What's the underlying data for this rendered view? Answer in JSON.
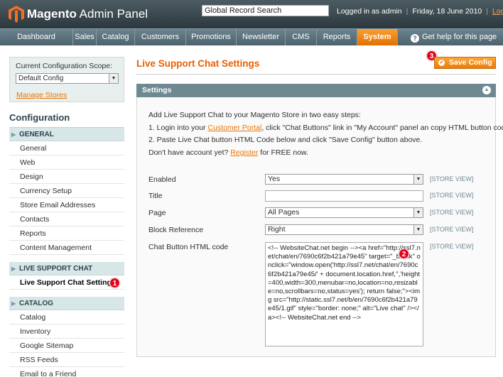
{
  "header": {
    "logo_brand": "Magento",
    "logo_suffix": " Admin Panel",
    "search_value": "Global Record Search",
    "logged_in": "Logged in as admin",
    "date": "Friday, 18 June 2010",
    "logout": "Log Out"
  },
  "nav": {
    "items": [
      "Dashboard",
      "Sales",
      "Catalog",
      "Customers",
      "Promotions",
      "Newsletter",
      "CMS",
      "Reports",
      "System"
    ],
    "active": "System",
    "help": "Get help for this page",
    "active_color": "#f18200"
  },
  "scope": {
    "label": "Current Configuration Scope:",
    "value": "Default Config",
    "manage": "Manage Stores"
  },
  "sidebar": {
    "title": "Configuration",
    "general_header": "GENERAL",
    "general_items": [
      "General",
      "Web",
      "Design",
      "Currency Setup",
      "Store Email Addresses",
      "Contacts",
      "Reports",
      "Content Management"
    ],
    "lsc_header": "LIVE SUPPORT CHAT",
    "lsc_item": "Live Support Chat Settings",
    "catalog_header": "CATALOG",
    "catalog_items": [
      "Catalog",
      "Inventory",
      "Google Sitemap",
      "RSS Feeds",
      "Email to a Friend"
    ]
  },
  "main": {
    "title": "Live Support Chat Settings",
    "save": "Save Config",
    "panel_title": "Settings",
    "intro": "Add Live Support Chat to your Magento Store in two easy steps:",
    "step1_pre": "1.  Login into your ",
    "step1_link": "Customer Portal",
    "step1_post": ", click \"Chat Buttons\" link in \"My Account\" panel an copy HTML button code.",
    "step2": "2.  Paste Live Chat button HTML Code below and click \"Save Config\" button above.",
    "noacc_pre": "Don't have account yet? ",
    "noacc_link": "Register",
    "noacc_post": " for FREE now.",
    "fields": {
      "enabled_label": "Enabled",
      "enabled_value": "Yes",
      "title_label": "Title",
      "page_label": "Page",
      "page_value": "All Pages",
      "block_label": "Block Reference",
      "block_value": "Right",
      "code_label": "Chat Button HTML code",
      "code_value": "<!-- WebsiteChat.net begin --><a href=\"http://ssl7.net/chat/en/7690c6f2b421a79e45\" target=\"_blank\" onclick=\"window.open('http://ssl7.net/chat/en/7690c6f2b421a79e45/' + document.location.href,'','height=400,width=300,menubar=no,location=no,resizable=no,scrollbars=no,status=yes'); return false;\"><img src=\"http://static.ssl7.net/b/en/7690c6f2b421a79e45/1.gif\" style=\"border: none;\" alt=\"Live chat\" /></a><!-- WebsiteChat.net end -->",
      "scope_tag": "[STORE VIEW]"
    }
  },
  "badges": [
    "1",
    "2",
    "3"
  ]
}
